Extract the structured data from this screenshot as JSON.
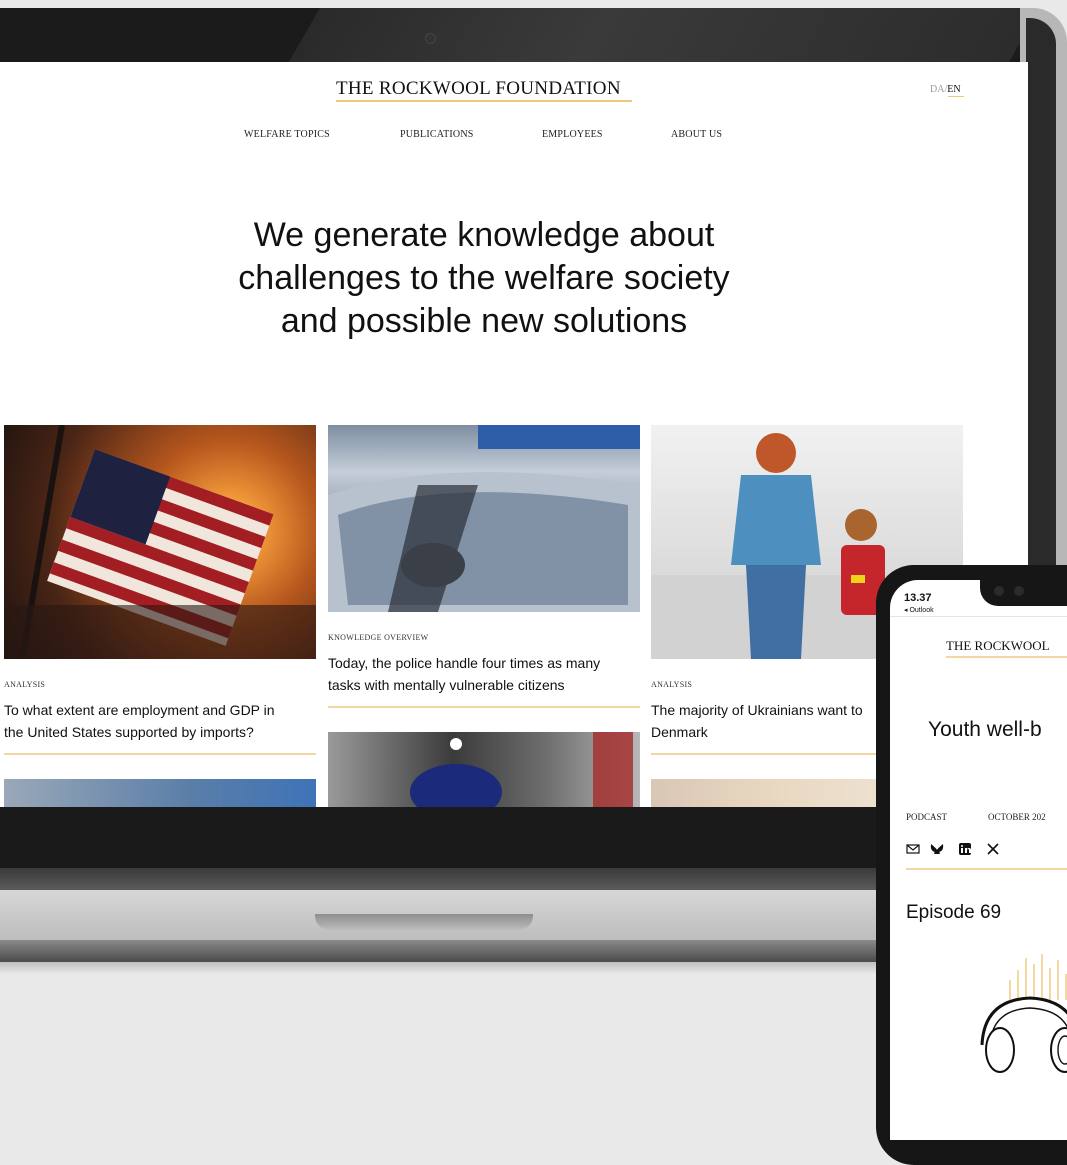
{
  "site": {
    "logo": "THE ROCKWOOL FOUNDATION",
    "lang_da": "DA",
    "lang_sep": "/",
    "lang_en": "EN",
    "nav": [
      "WELFARE TOPICS",
      "PUBLICATIONS",
      "EMPLOYEES",
      "ABOUT US"
    ],
    "hero_lines": [
      "We generate knowledge about",
      "challenges to the welfare society",
      "and possible new solutions"
    ],
    "cards": [
      {
        "kicker": "ANALYSIS",
        "title_lines": [
          "To what extent are employment and GDP in",
          "the United States supported by imports?"
        ]
      },
      {
        "kicker": "KNOWLEDGE OVERVIEW",
        "title_lines": [
          "Today, the police handle four times as many",
          "tasks with mentally vulnerable citizens"
        ]
      },
      {
        "kicker": "ANALYSIS",
        "title_lines": [
          "The majority of Ukrainians want to",
          "Denmark"
        ]
      }
    ]
  },
  "phone": {
    "time": "13.37",
    "back_app": "◂ Outlook",
    "logo": "THE ROCKWOOL",
    "headline": "Youth well-b",
    "meta_type": "PODCAST",
    "meta_date": "OCTOBER 202",
    "share_icons": [
      "mail-icon",
      "bluesky-icon",
      "linkedin-icon",
      "x-icon"
    ],
    "episode": "Episode 69"
  },
  "colors": {
    "accent_rule": "#f0c77b",
    "background": "#e9e9e9",
    "device": "#1b1b1b"
  }
}
